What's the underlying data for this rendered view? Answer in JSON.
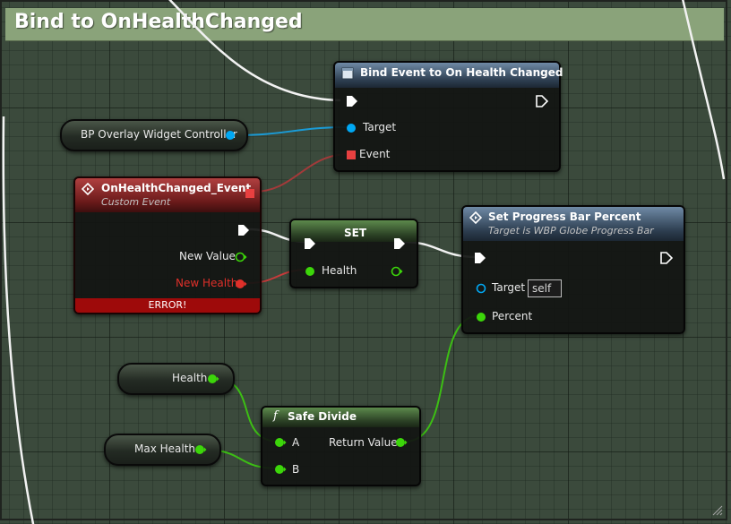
{
  "comment": {
    "title": "Bind to OnHealthChanged",
    "color": "#8aa37a"
  },
  "colors": {
    "exec": "#ffffff",
    "object_pin": "#00a8f4",
    "float_pin": "#3cd60a",
    "delegate_pin": "#e84040",
    "error": "#9e0a0a"
  },
  "nodes": {
    "bind_event": {
      "title": "Bind Event to On Health Changed",
      "icon": "event-dispatcher-icon",
      "pins": {
        "target": "Target",
        "event": "Event"
      }
    },
    "controller": {
      "label": "BP Overlay Widget Controller"
    },
    "custom_event": {
      "title": "OnHealthChanged_Event",
      "subtitle": "Custom Event",
      "icon": "event-diamond-icon",
      "pins": {
        "new_value": "New Value",
        "new_health": "New Health"
      },
      "error": "ERROR!"
    },
    "set": {
      "title": "SET",
      "pins": {
        "health": "Health"
      }
    },
    "set_progress": {
      "title": "Set Progress Bar Percent",
      "subtitle": "Target is WBP Globe Progress Bar",
      "icon": "function-diamond-icon",
      "pins": {
        "target": "Target",
        "target_value": "self",
        "percent": "Percent"
      }
    },
    "health_var": {
      "label": "Health"
    },
    "max_health_var": {
      "label": "Max Health"
    },
    "safe_divide": {
      "title": "Safe Divide",
      "icon": "function-f-icon",
      "pins": {
        "a": "A",
        "b": "B",
        "return_value": "Return Value"
      }
    }
  }
}
